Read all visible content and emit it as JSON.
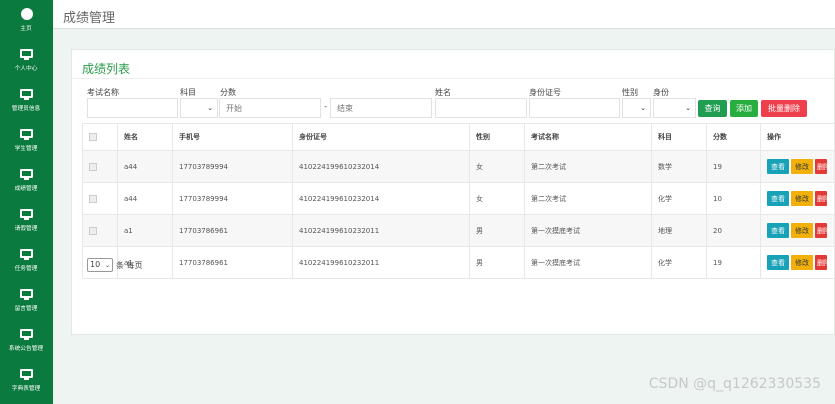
{
  "sidebar": {
    "items": [
      {
        "label": "主页",
        "icon": "dashboard-icon"
      },
      {
        "label": "个人中心",
        "icon": "monitor-icon"
      },
      {
        "label": "管理员信息",
        "icon": "monitor-icon"
      },
      {
        "label": "学生管理",
        "icon": "monitor-icon"
      },
      {
        "label": "成绩管理",
        "icon": "monitor-icon"
      },
      {
        "label": "请假管理",
        "icon": "monitor-icon"
      },
      {
        "label": "任务管理",
        "icon": "monitor-icon"
      },
      {
        "label": "留言管理",
        "icon": "monitor-icon"
      },
      {
        "label": "系统公告管理",
        "icon": "monitor-icon"
      },
      {
        "label": "字典表管理",
        "icon": "monitor-icon"
      }
    ]
  },
  "header": {
    "title": "成绩管理"
  },
  "card": {
    "title": "成绩列表"
  },
  "filters": {
    "exam_name_label": "考试名称",
    "subject_label": "科目",
    "score_label": "分数",
    "score_start_placeholder": "开始",
    "score_end_placeholder": "结束",
    "score_sep": "-",
    "name_label": "姓名",
    "id_label": "身份证号",
    "gender_label": "性别",
    "identity_label": "身份",
    "query_button": "查询",
    "add_button": "添加",
    "batch_delete_button": "批量删除"
  },
  "table": {
    "columns": [
      "姓名",
      "手机号",
      "身份证号",
      "性别",
      "考试名称",
      "科目",
      "分数",
      "操作"
    ],
    "rows": [
      {
        "name": "a44",
        "phone": "17703789994",
        "id_card": "410224199610232014",
        "gender": "女",
        "exam": "第二次考试",
        "subject": "数学",
        "score": "19"
      },
      {
        "name": "a44",
        "phone": "17703789994",
        "id_card": "410224199610232014",
        "gender": "女",
        "exam": "第二次考试",
        "subject": "化学",
        "score": "10"
      },
      {
        "name": "a1",
        "phone": "17703786961",
        "id_card": "410224199610232011",
        "gender": "男",
        "exam": "第一次摸底考试",
        "subject": "地理",
        "score": "20"
      },
      {
        "name": "a1",
        "phone": "17703786961",
        "id_card": "410224199610232011",
        "gender": "男",
        "exam": "第一次摸底考试",
        "subject": "化学",
        "score": "19"
      }
    ],
    "actions": {
      "view": "查看",
      "edit": "修改",
      "delete": "删除"
    }
  },
  "pagination": {
    "page_size": "10",
    "per_page_label": "条 每页"
  },
  "watermark": "CSDN @q_q1262330535",
  "colors": {
    "sidebar": "#0a7a3e",
    "accent": "#2a9a4a",
    "danger": "#ee3f4d",
    "info": "#17a2b8",
    "warning": "#f2b10a"
  }
}
